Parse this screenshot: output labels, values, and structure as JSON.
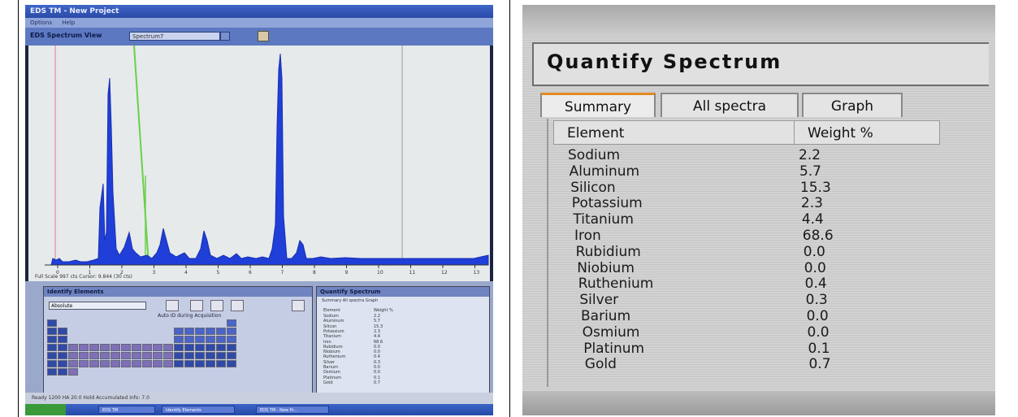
{
  "left_photo": {
    "window_title": "EDS TM - New Project",
    "menu": [
      "Options",
      "Help"
    ],
    "spectrum_view": {
      "title": "EDS Spectrum View",
      "dropdown_value": "Spectrum7",
      "status": "Full Scale 997 cts Cursor: 9.844 (30 cts)",
      "x_ticks": [
        "0",
        "1",
        "2",
        "3",
        "4",
        "5",
        "6",
        "7",
        "8",
        "9",
        "10",
        "11",
        "12",
        "13"
      ]
    },
    "identify_elements": {
      "title": "Identify Elements",
      "element_select": "Absolute",
      "auto_id": "Auto ID during Acquisition"
    },
    "quantify_spectrum_small": {
      "title": "Quantify Spectrum",
      "tabs": "Summary  All spectra  Graph",
      "header_element": "Element",
      "header_weight": "Weight %"
    },
    "status_bar": "Ready   1200   HA   20.0   Hold   Accumulated info: 7.0",
    "taskbar_items": [
      "EDS TM",
      "Identify Elements",
      "EDS TM - New Pr..."
    ]
  },
  "right_photo": {
    "title": "Quantify Spectrum",
    "tabs": [
      {
        "label": "Summary",
        "active": true
      },
      {
        "label": "All spectra",
        "active": false
      },
      {
        "label": "Graph",
        "active": false
      }
    ],
    "columns": {
      "element": "Element",
      "weight": "Weight %"
    },
    "rows": [
      {
        "element": "Sodium",
        "weight": "2.2"
      },
      {
        "element": "Aluminum",
        "weight": "5.7"
      },
      {
        "element": "Silicon",
        "weight": "15.3"
      },
      {
        "element": "Potassium",
        "weight": "2.3"
      },
      {
        "element": "Titanium",
        "weight": "4.4"
      },
      {
        "element": "Iron",
        "weight": "68.6"
      },
      {
        "element": "Rubidium",
        "weight": "0.0"
      },
      {
        "element": "Niobium",
        "weight": "0.0"
      },
      {
        "element": "Ruthenium",
        "weight": "0.4"
      },
      {
        "element": "Silver",
        "weight": "0.3"
      },
      {
        "element": "Barium",
        "weight": "0.0"
      },
      {
        "element": "Osmium",
        "weight": "0.0"
      },
      {
        "element": "Platinum",
        "weight": "0.1"
      },
      {
        "element": "Gold",
        "weight": "0.7"
      }
    ]
  },
  "colors": {
    "spectrum_fill": "#1f3fd8",
    "marker_green": "#6ad04a",
    "tab_accent": "#e08a20"
  }
}
